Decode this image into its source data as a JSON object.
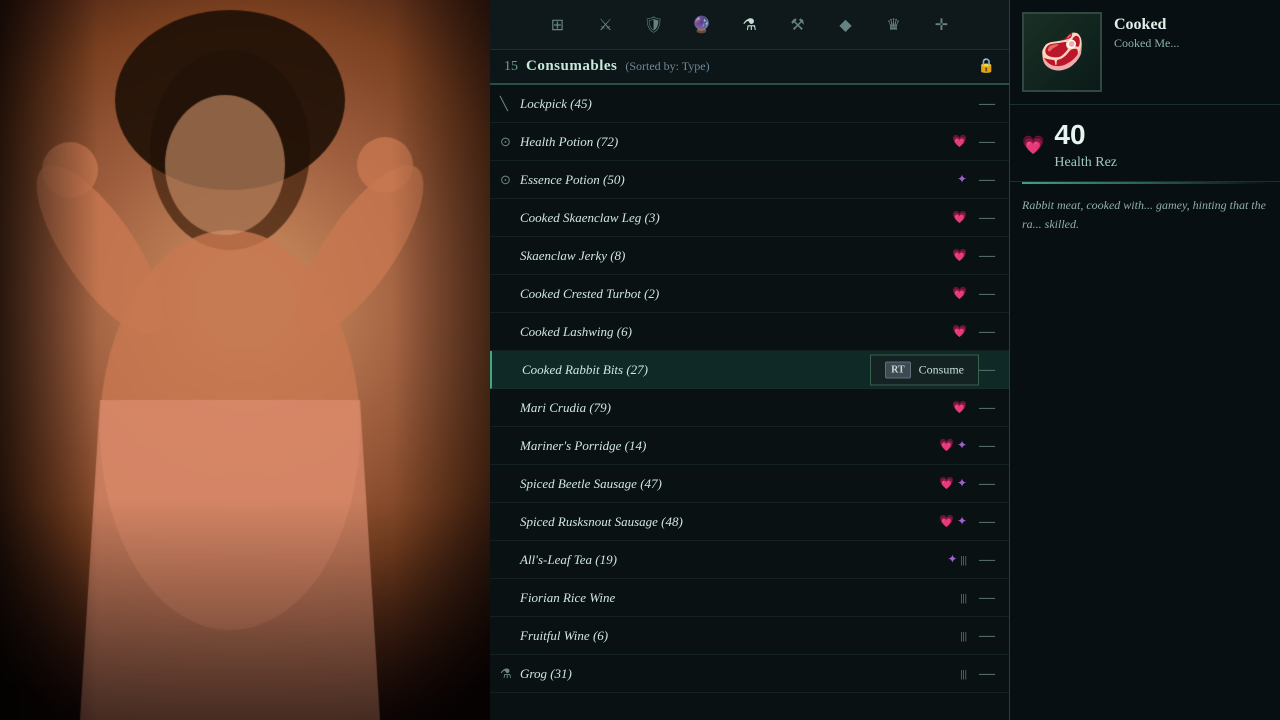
{
  "background": {
    "description": "Person celebrating with raised fists"
  },
  "header": {
    "icons": [
      {
        "name": "map-icon",
        "symbol": "⊞",
        "active": false
      },
      {
        "name": "combat-icon",
        "symbol": "⚔",
        "active": false
      },
      {
        "name": "shield-icon",
        "symbol": "🛡",
        "active": false
      },
      {
        "name": "skills-icon",
        "symbol": "🔮",
        "active": false
      },
      {
        "name": "potion-icon",
        "symbol": "⚗",
        "active": false
      },
      {
        "name": "anvil-icon",
        "symbol": "⚒",
        "active": false
      },
      {
        "name": "gem-icon",
        "symbol": "💎",
        "active": false
      },
      {
        "name": "crown-icon",
        "symbol": "♛",
        "active": false
      },
      {
        "name": "compass-icon",
        "symbol": "✛",
        "active": false
      }
    ],
    "level_badge": "15"
  },
  "category": {
    "title": "Consumables",
    "sort_label": "(Sorted by: Type)",
    "icon": "🧪"
  },
  "items": [
    {
      "id": 1,
      "name": "Lockpick",
      "count": 45,
      "icons": [],
      "prefix_icon": "╲",
      "selected": false
    },
    {
      "id": 2,
      "name": "Health Potion",
      "count": 72,
      "icons": [
        "heart"
      ],
      "prefix_icon": "⚗",
      "selected": false
    },
    {
      "id": 3,
      "name": "Essence Potion",
      "count": 50,
      "icons": [
        "essence"
      ],
      "prefix_icon": "⚗",
      "selected": false
    },
    {
      "id": 4,
      "name": "Cooked Skaenclaw Leg",
      "count": 3,
      "icons": [
        "heart"
      ],
      "prefix_icon": "",
      "selected": false
    },
    {
      "id": 5,
      "name": "Skaenclaw Jerky",
      "count": 8,
      "icons": [
        "heart"
      ],
      "prefix_icon": "",
      "selected": false
    },
    {
      "id": 6,
      "name": "Cooked Crested Turbot",
      "count": 2,
      "icons": [
        "heart"
      ],
      "prefix_icon": "",
      "selected": false
    },
    {
      "id": 7,
      "name": "Cooked Lashwing",
      "count": 6,
      "icons": [
        "heart"
      ],
      "prefix_icon": "",
      "selected": false
    },
    {
      "id": 8,
      "name": "Cooked Rabbit Bits",
      "count": 27,
      "icons": [
        "heart"
      ],
      "prefix_icon": "",
      "selected": true,
      "has_tooltip": true,
      "tooltip": "Consume"
    },
    {
      "id": 9,
      "name": "Mari Crudia",
      "count": 79,
      "icons": [
        "heart"
      ],
      "prefix_icon": "",
      "selected": false
    },
    {
      "id": 10,
      "name": "Mariner's Porridge",
      "count": 14,
      "icons": [
        "heart",
        "essence"
      ],
      "prefix_icon": "",
      "selected": false
    },
    {
      "id": 11,
      "name": "Spiced Beetle Sausage",
      "count": 47,
      "icons": [
        "heart",
        "essence"
      ],
      "prefix_icon": "",
      "selected": false
    },
    {
      "id": 12,
      "name": "Spiced Rusksnout Sausage",
      "count": 48,
      "icons": [
        "heart",
        "essence"
      ],
      "prefix_icon": "",
      "selected": false
    },
    {
      "id": 13,
      "name": "All's-Leaf Tea",
      "count": 19,
      "icons": [
        "essence",
        "stamina"
      ],
      "prefix_icon": "",
      "selected": false
    },
    {
      "id": 14,
      "name": "Fiorian Rice Wine",
      "count": null,
      "icons": [
        "stamina"
      ],
      "prefix_icon": "",
      "selected": false
    },
    {
      "id": 15,
      "name": "Fruitful Wine",
      "count": 6,
      "icons": [
        "stamina"
      ],
      "prefix_icon": "",
      "selected": false
    },
    {
      "id": 16,
      "name": "Grog",
      "count": 31,
      "icons": [
        "stamina"
      ],
      "prefix_icon": "⚗",
      "selected": false
    }
  ],
  "detail": {
    "item_name_main": "Cooked",
    "item_name_sub": "Cooked Me...",
    "stat_value": "40",
    "stat_label": "Health Rez",
    "description": "Rabbit meat, cooked with... gamey, hinting that the ra... skilled.",
    "thumbnail_emoji": "🥩"
  },
  "tooltip": {
    "button_label": "RT",
    "action_label": "Consume"
  }
}
